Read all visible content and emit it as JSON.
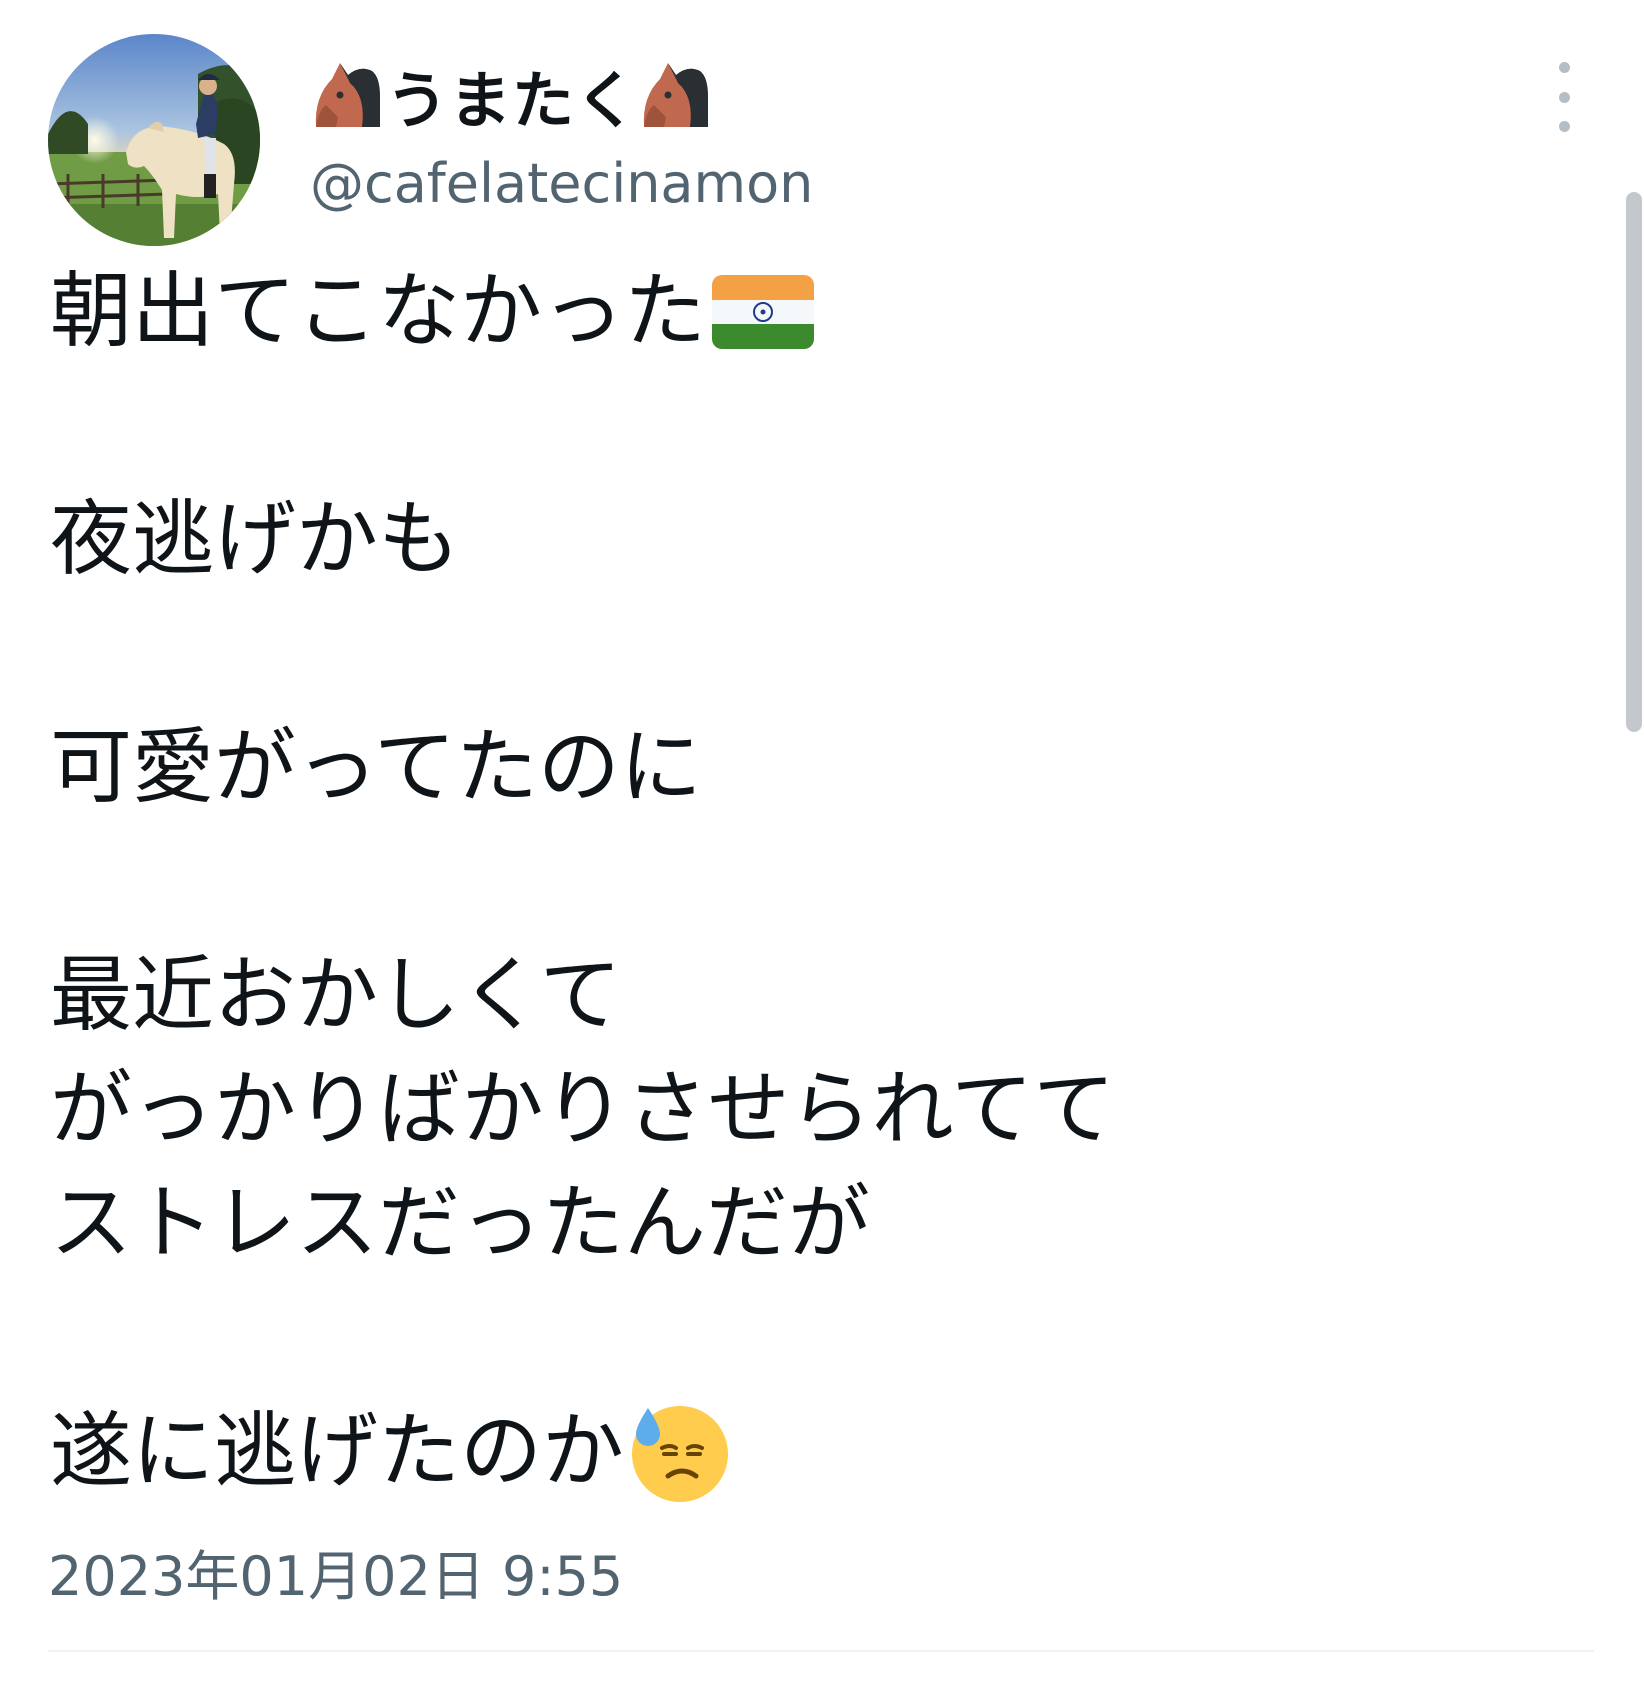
{
  "author": {
    "display_name": "うまたく",
    "handle": "@cafelatecinamon",
    "name_icons": [
      "horse-face-icon",
      "horse-face-icon"
    ]
  },
  "tweet": {
    "lines": [
      "朝出てこなかった",
      "",
      "夜逃げかも",
      "",
      "可愛がってたのに",
      "",
      "最近おかしくて",
      "がっかりばかりさせられてて",
      "ストレスだったんだが",
      "",
      "遂に逃げたのか"
    ],
    "inline_emoji": {
      "line_0": "india-flag-icon",
      "line_10": "downcast-face-with-sweat-icon"
    },
    "timestamp": "2023年01月02日 9:55"
  },
  "colors": {
    "text": "#0f1419",
    "secondary": "#536471",
    "divider": "#eff3f4",
    "scrollbar": "#c4c8cc"
  }
}
